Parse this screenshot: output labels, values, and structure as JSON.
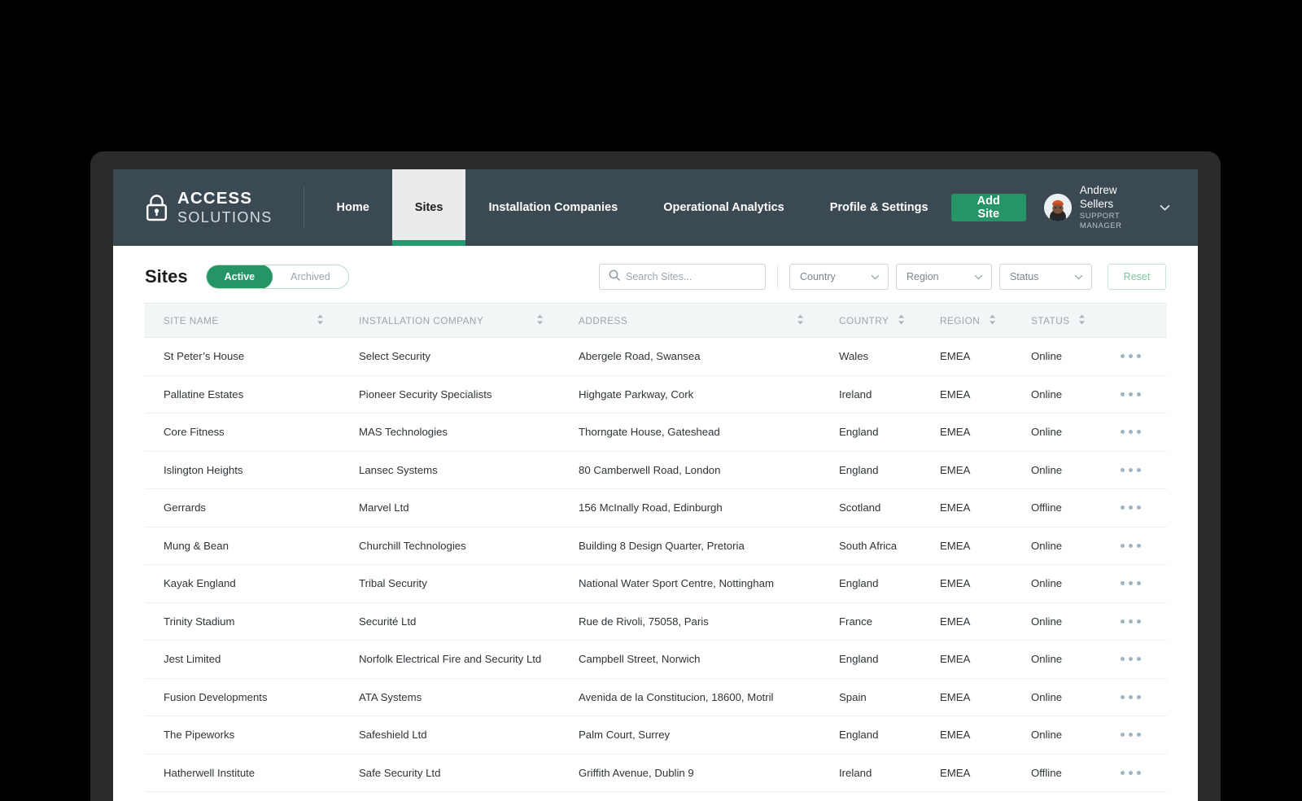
{
  "brand": {
    "line1": "ACCESS",
    "line2": "SOLUTIONS",
    "icon": "lock-icon"
  },
  "nav": {
    "items": [
      {
        "label": "Home",
        "active": false
      },
      {
        "label": "Sites",
        "active": true
      },
      {
        "label": "Installation Companies",
        "active": false
      },
      {
        "label": "Operational Analytics",
        "active": false
      },
      {
        "label": "Profile & Settings",
        "active": false
      }
    ],
    "add_site_label": "Add Site",
    "user": {
      "name": "Andrew Sellers",
      "role": "SUPPORT MANAGER",
      "chevron": "chevron-down-icon"
    }
  },
  "toolbar": {
    "title": "Sites",
    "segmented": {
      "active_label": "Active",
      "archived_label": "Archived",
      "selected": "Active"
    },
    "search": {
      "placeholder": "Search Sites...",
      "value": "",
      "icon": "search-icon"
    },
    "filters": [
      {
        "name": "country",
        "label": "Country",
        "value": ""
      },
      {
        "name": "region",
        "label": "Region",
        "value": ""
      },
      {
        "name": "status",
        "label": "Status",
        "value": ""
      }
    ],
    "reset_label": "Reset"
  },
  "table": {
    "columns": [
      {
        "key": "site",
        "label": "SITE NAME",
        "sortable": true
      },
      {
        "key": "company",
        "label": "INSTALLATION COMPANY",
        "sortable": true
      },
      {
        "key": "address",
        "label": "ADDRESS",
        "sortable": true
      },
      {
        "key": "country",
        "label": "COUNTRY",
        "sortable": true
      },
      {
        "key": "region",
        "label": "REGION",
        "sortable": true
      },
      {
        "key": "status",
        "label": "STATUS",
        "sortable": true
      }
    ],
    "rows": [
      {
        "site": "St Peter’s House",
        "company": "Select Security",
        "address": "Abergele Road, Swansea",
        "country": "Wales",
        "region": "EMEA",
        "status": "Online"
      },
      {
        "site": "Pallatine Estates",
        "company": "Pioneer Security Specialists",
        "address": "Highgate Parkway, Cork",
        "country": "Ireland",
        "region": "EMEA",
        "status": "Online"
      },
      {
        "site": "Core Fitness",
        "company": "MAS Technologies",
        "address": "Thorngate House, Gateshead",
        "country": "England",
        "region": "EMEA",
        "status": "Online"
      },
      {
        "site": "Islington Heights",
        "company": "Lansec Systems",
        "address": "80 Camberwell Road, London",
        "country": "England",
        "region": "EMEA",
        "status": "Online"
      },
      {
        "site": "Gerrards",
        "company": "Marvel Ltd",
        "address": "156 McInally Road, Edinburgh",
        "country": "Scotland",
        "region": "EMEA",
        "status": "Offline"
      },
      {
        "site": "Mung & Bean",
        "company": "Churchill Technologies",
        "address": "Building 8 Design Quarter, Pretoria",
        "country": "South Africa",
        "region": "EMEA",
        "status": "Online"
      },
      {
        "site": "Kayak England",
        "company": "Tribal Security",
        "address": "National Water Sport Centre, Nottingham",
        "country": "England",
        "region": "EMEA",
        "status": "Online"
      },
      {
        "site": "Trinity Stadium",
        "company": "Securité Ltd",
        "address": "Rue de Rivoli, 75058, Paris",
        "country": "France",
        "region": "EMEA",
        "status": "Online"
      },
      {
        "site": "Jest Limited",
        "company": "Norfolk Electrical Fire and Security Ltd",
        "address": "Campbell Street, Norwich",
        "country": "England",
        "region": "EMEA",
        "status": "Online"
      },
      {
        "site": "Fusion Developments",
        "company": "ATA Systems",
        "address": "Avenida de la Constitucion, 18600, Motril",
        "country": "Spain",
        "region": "EMEA",
        "status": "Online"
      },
      {
        "site": "The Pipeworks",
        "company": "Safeshield Ltd",
        "address": "Palm Court, Surrey",
        "country": "England",
        "region": "EMEA",
        "status": "Online"
      },
      {
        "site": "Hatherwell Institute",
        "company": "Safe Security Ltd",
        "address": "Griffith Avenue, Dublin 9",
        "country": "Ireland",
        "region": "EMEA",
        "status": "Offline"
      }
    ],
    "row_action_icon": "ellipsis-icon"
  },
  "colors": {
    "nav_background": "#3b4a52",
    "accent_green": "#259567",
    "frame": "#2b2b2b",
    "header_row": "#f2f6f7",
    "dots": "#9fb4c4"
  }
}
